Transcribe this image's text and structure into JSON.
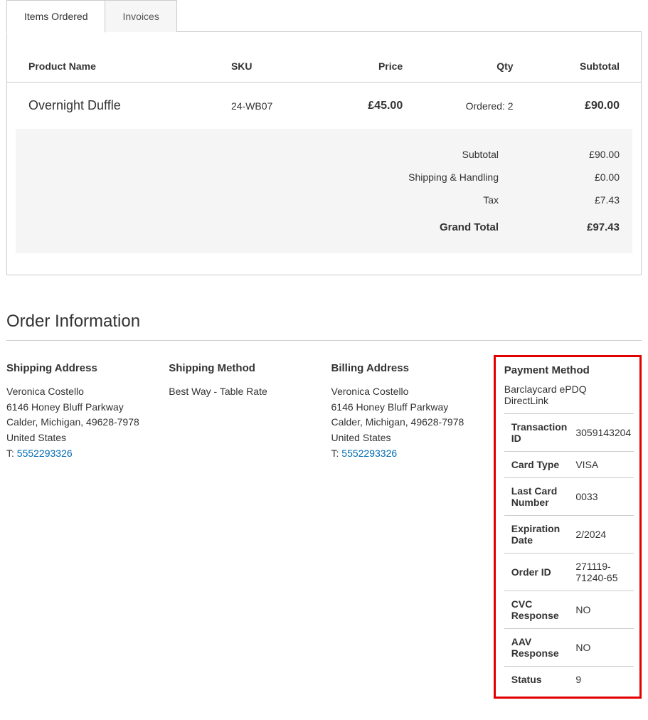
{
  "tabs": {
    "items_ordered": "Items Ordered",
    "invoices": "Invoices"
  },
  "items_table": {
    "headers": {
      "product": "Product Name",
      "sku": "SKU",
      "price": "Price",
      "qty": "Qty",
      "subtotal": "Subtotal"
    },
    "rows": [
      {
        "product": "Overnight Duffle",
        "sku": "24-WB07",
        "price": "£45.00",
        "qty": "Ordered: 2",
        "subtotal": "£90.00"
      }
    ]
  },
  "totals": {
    "subtotal_label": "Subtotal",
    "subtotal_value": "£90.00",
    "shipping_label": "Shipping & Handling",
    "shipping_value": "£0.00",
    "tax_label": "Tax",
    "tax_value": "£7.43",
    "grand_label": "Grand Total",
    "grand_value": "£97.43"
  },
  "order_info_title": "Order Information",
  "shipping_address": {
    "title": "Shipping Address",
    "name": "Veronica Costello",
    "street": "6146 Honey Bluff Parkway",
    "city": "Calder, Michigan, 49628-7978",
    "country": "United States",
    "phone_prefix": "T: ",
    "phone": "5552293326"
  },
  "shipping_method": {
    "title": "Shipping Method",
    "value": "Best Way - Table Rate"
  },
  "billing_address": {
    "title": "Billing Address",
    "name": "Veronica Costello",
    "street": "6146 Honey Bluff Parkway",
    "city": "Calder, Michigan, 49628-7978",
    "country": "United States",
    "phone_prefix": "T: ",
    "phone": "5552293326"
  },
  "payment_method": {
    "title": "Payment Method",
    "name": "Barclaycard ePDQ DirectLink",
    "rows": {
      "transaction_id_label": "Transaction ID",
      "transaction_id_value": "3059143204",
      "card_type_label": "Card Type",
      "card_type_value": "VISA",
      "last_card_label": "Last Card Number",
      "last_card_value": "0033",
      "exp_label": "Expiration Date",
      "exp_value": "2/2024",
      "order_id_label": "Order ID",
      "order_id_value": "271119-71240-65",
      "cvc_label": "CVC Response",
      "cvc_value": "NO",
      "aav_label": "AAV Response",
      "aav_value": "NO",
      "status_label": "Status",
      "status_value": "9"
    }
  }
}
